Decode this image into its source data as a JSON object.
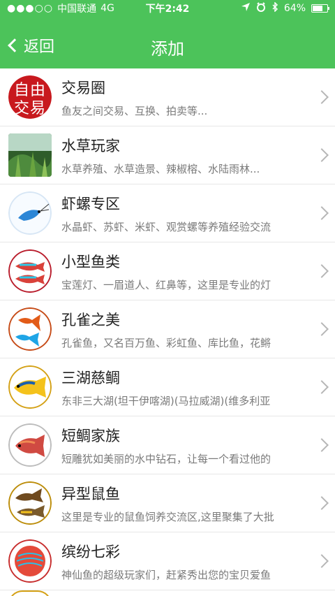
{
  "status_bar": {
    "signal": "●●●○○",
    "carrier": "中国联通",
    "network": "4G",
    "time": "下午2:42",
    "battery_percent": "64%",
    "battery_level": 0.64,
    "icons": [
      "location-arrow-icon",
      "alarm-icon",
      "bluetooth-icon",
      "battery-icon"
    ]
  },
  "nav": {
    "back_label": "返回",
    "title": "添加"
  },
  "items": [
    {
      "title": "交易圈",
      "desc": "鱼友之间交易、互换、拍卖等..."
    },
    {
      "title": "水草玩家",
      "desc": "水草养殖、水草造景、辣椒榕、水陆雨林..."
    },
    {
      "title": "虾螺专区",
      "desc": "水晶虾、苏虾、米虾、观赏螺等养殖经验交流"
    },
    {
      "title": "小型鱼类",
      "desc": "宝莲灯、一眉道人、红鼻等，这里是专业的灯"
    },
    {
      "title": "孔雀之美",
      "desc": "孔雀鱼，又名百万鱼、彩虹鱼、库比鱼，花鳉"
    },
    {
      "title": "三湖慈鲷",
      "desc": "东非三大湖(坦干伊喀湖)(马拉威湖)(维多利亚"
    },
    {
      "title": "短鲷家族",
      "desc": "短雕犹如美丽的水中钻石，让每一个看过他的"
    },
    {
      "title": "异型鼠鱼",
      "desc": "这里是专业的鼠鱼饲养交流区,这里聚集了大批"
    },
    {
      "title": "缤纷七彩",
      "desc": "神仙鱼的超级玩家们，赶紧秀出您的宝贝爱鱼"
    }
  ],
  "logo_text": [
    "自",
    "由",
    "交",
    "易"
  ],
  "colors": {
    "accent": "#4cc35a",
    "logo_red": "#c8191e"
  }
}
